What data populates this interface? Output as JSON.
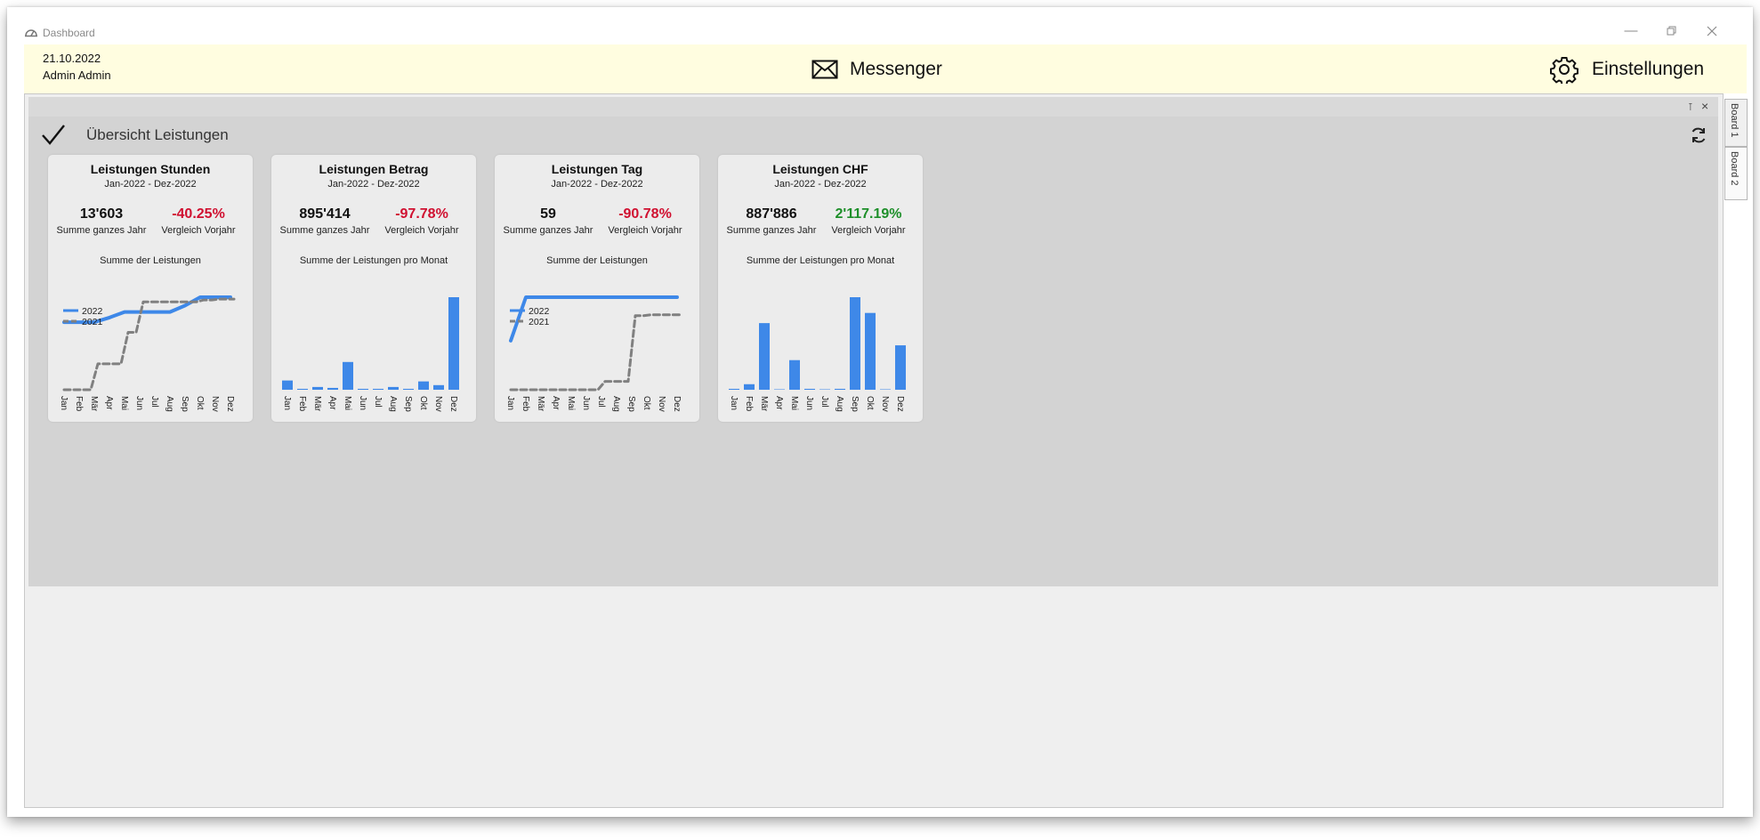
{
  "window": {
    "title": "Dashboard"
  },
  "topbar": {
    "date": "21.10.2022",
    "user": "Admin Admin",
    "messenger_label": "Messenger",
    "settings_label": "Einstellungen"
  },
  "board": {
    "title": "Übersicht Leistungen"
  },
  "tabs": [
    {
      "label": "Board 1"
    },
    {
      "label": "Board 2"
    }
  ],
  "colors": {
    "up": "#1e8f2a",
    "down": "#d01030",
    "series_current": "#3e88e8",
    "series_previous": "#808080"
  },
  "cards": [
    {
      "title": "Leistungen Stunden",
      "period": "Jan-2022 - Dez-2022",
      "total": "13'603",
      "total_label": "Summe ganzes Jahr",
      "change": "-40.25%",
      "change_label": "Vergleich Vorjahr",
      "trend": "down",
      "chart_title": "Summe der Leistungen"
    },
    {
      "title": "Leistungen Betrag",
      "period": "Jan-2022 - Dez-2022",
      "total": "895'414",
      "total_label": "Summe ganzes Jahr",
      "change": "-97.78%",
      "change_label": "Vergleich Vorjahr",
      "trend": "down",
      "chart_title": "Summe der Leistungen pro Monat"
    },
    {
      "title": "Leistungen Tag",
      "period": "Jan-2022 - Dez-2022",
      "total": "59",
      "total_label": "Summe ganzes Jahr",
      "change": "-90.78%",
      "change_label": "Vergleich Vorjahr",
      "trend": "down",
      "chart_title": "Summe der Leistungen"
    },
    {
      "title": "Leistungen CHF",
      "period": "Jan-2022 - Dez-2022",
      "total": "887'886",
      "total_label": "Summe ganzes Jahr",
      "change": "2'117.19%",
      "change_label": "Vergleich Vorjahr",
      "trend": "up",
      "chart_title": "Summe der Leistungen pro Monat"
    }
  ],
  "chart_data": [
    {
      "type": "line",
      "title": "Summe der Leistungen",
      "categories": [
        "Jan",
        "Feb",
        "Mär",
        "Apr",
        "Mai",
        "Jun",
        "Jul",
        "Aug",
        "Sep",
        "Okt",
        "Nov",
        "Dez"
      ],
      "ylim": [
        0,
        100
      ],
      "legend": "top-left",
      "series": [
        {
          "name": "2022",
          "style": "solid",
          "values": [
            73,
            73,
            73,
            78,
            84,
            84,
            84,
            84,
            91,
            100,
            100,
            100
          ]
        },
        {
          "name": "2021",
          "style": "dashed",
          "values": [
            0,
            0,
            28,
            28,
            62,
            95,
            95,
            95,
            95,
            97,
            98,
            98
          ]
        }
      ]
    },
    {
      "type": "bar",
      "title": "Summe der Leistungen pro Monat",
      "categories": [
        "Jan",
        "Feb",
        "Mär",
        "Apr",
        "Mai",
        "Jun",
        "Jul",
        "Aug",
        "Sep",
        "Okt",
        "Nov",
        "Dez"
      ],
      "ylim": [
        0,
        100
      ],
      "values": [
        10,
        1,
        3,
        2,
        30,
        1,
        1,
        3,
        1,
        9,
        5,
        100
      ]
    },
    {
      "type": "line",
      "title": "Summe der Leistungen",
      "categories": [
        "Jan",
        "Feb",
        "Mär",
        "Apr",
        "Mai",
        "Jun",
        "Jul",
        "Aug",
        "Sep",
        "Okt",
        "Nov",
        "Dez"
      ],
      "ylim": [
        0,
        100
      ],
      "legend": "top-left",
      "series": [
        {
          "name": "2022",
          "style": "solid",
          "values": [
            53,
            100,
            100,
            100,
            100,
            100,
            100,
            100,
            100,
            100,
            100,
            100
          ]
        },
        {
          "name": "2021",
          "style": "dashed",
          "values": [
            0,
            0,
            0,
            0,
            0,
            0,
            9,
            9,
            80,
            81,
            81,
            81
          ]
        }
      ]
    },
    {
      "type": "bar",
      "title": "Summe der Leistungen pro Monat",
      "categories": [
        "Jan",
        "Feb",
        "Mär",
        "Apr",
        "Mai",
        "Jun",
        "Jul",
        "Aug",
        "Sep",
        "Okt",
        "Nov",
        "Dez"
      ],
      "ylim": [
        0,
        100
      ],
      "values": [
        1,
        6,
        72,
        0,
        32,
        1,
        0,
        1,
        100,
        83,
        0,
        48
      ]
    }
  ]
}
